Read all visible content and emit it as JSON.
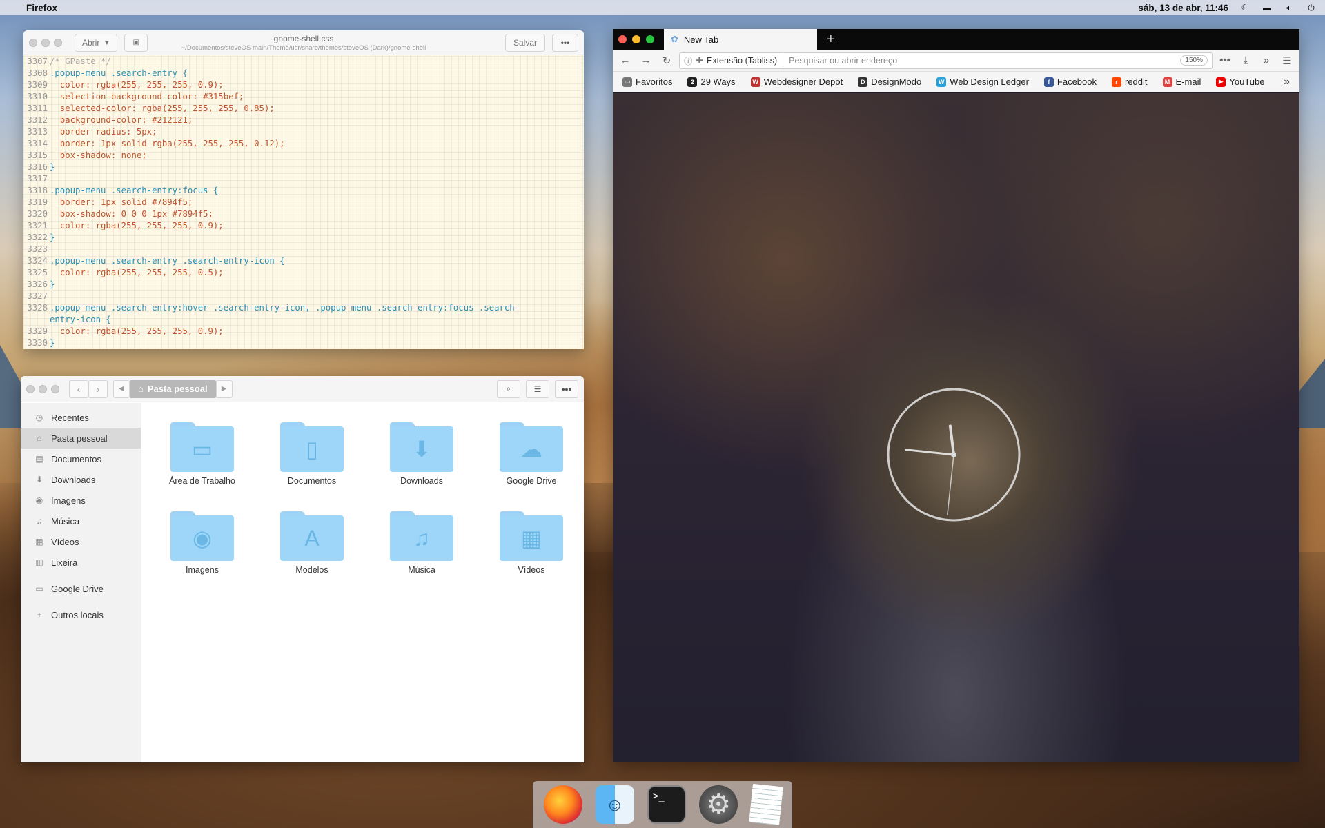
{
  "topbar": {
    "app": "Firefox",
    "datetime": "sáb, 13 de abr, 11:46",
    "icons": [
      "apple-icon",
      "night-mode-icon",
      "keyboard-icon",
      "volume-icon",
      "power-icon"
    ]
  },
  "editor": {
    "open_label": "Abrir",
    "filename": "gnome-shell.css",
    "path": "~/Documentos/steveOS main/Theme/usr/share/themes/steveOS (Dark)/gnome-shell",
    "save_label": "Salvar",
    "menu_label": "•••",
    "lines": [
      {
        "n": "3307",
        "t": "/* GPaste */"
      },
      {
        "n": "3308",
        "t": ".popup-menu .search-entry {"
      },
      {
        "n": "3309",
        "t": "  color: rgba(255, 255, 255, 0.9);"
      },
      {
        "n": "3310",
        "t": "  selection-background-color: #315bef;"
      },
      {
        "n": "3311",
        "t": "  selected-color: rgba(255, 255, 255, 0.85);"
      },
      {
        "n": "3312",
        "t": "  background-color: #212121;"
      },
      {
        "n": "3313",
        "t": "  border-radius: 5px;"
      },
      {
        "n": "3314",
        "t": "  border: 1px solid rgba(255, 255, 255, 0.12);"
      },
      {
        "n": "3315",
        "t": "  box-shadow: none;"
      },
      {
        "n": "3316",
        "t": "}"
      },
      {
        "n": "3317",
        "t": ""
      },
      {
        "n": "3318",
        "t": ".popup-menu .search-entry:focus {"
      },
      {
        "n": "3319",
        "t": "  border: 1px solid #7894f5;"
      },
      {
        "n": "3320",
        "t": "  box-shadow: 0 0 0 1px #7894f5;"
      },
      {
        "n": "3321",
        "t": "  color: rgba(255, 255, 255, 0.9);"
      },
      {
        "n": "3322",
        "t": "}"
      },
      {
        "n": "3323",
        "t": ""
      },
      {
        "n": "3324",
        "t": ".popup-menu .search-entry .search-entry-icon {"
      },
      {
        "n": "3325",
        "t": "  color: rgba(255, 255, 255, 0.5);"
      },
      {
        "n": "3326",
        "t": "}"
      },
      {
        "n": "3327",
        "t": ""
      },
      {
        "n": "3328",
        "t": ".popup-menu .search-entry:hover .search-entry-icon, .popup-menu .search-entry:focus .search-"
      },
      {
        "n": "",
        "t": "entry-icon {"
      },
      {
        "n": "3329",
        "t": "  color: rgba(255, 255, 255, 0.9);"
      },
      {
        "n": "3330",
        "t": "}"
      }
    ]
  },
  "files": {
    "breadcrumb": "Pasta pessoal",
    "sidebar": [
      {
        "label": "Recentes",
        "icon": "clock-icon",
        "glyph": "◷"
      },
      {
        "label": "Pasta pessoal",
        "icon": "home-icon",
        "glyph": "⌂",
        "selected": true
      },
      {
        "label": "Documentos",
        "icon": "document-icon",
        "glyph": "▤"
      },
      {
        "label": "Downloads",
        "icon": "download-icon",
        "glyph": "⬇"
      },
      {
        "label": "Imagens",
        "icon": "camera-icon",
        "glyph": "◉"
      },
      {
        "label": "Música",
        "icon": "music-icon",
        "glyph": "♫"
      },
      {
        "label": "Vídeos",
        "icon": "film-icon",
        "glyph": "▦"
      },
      {
        "label": "Lixeira",
        "icon": "trash-icon",
        "glyph": "▥"
      },
      {
        "label": "Google Drive",
        "icon": "drive-icon",
        "glyph": "▭"
      },
      {
        "label": "Outros locais",
        "icon": "plus-icon",
        "glyph": "+"
      }
    ],
    "folders": [
      {
        "label": "Área de Trabalho",
        "glyph": "▭"
      },
      {
        "label": "Documentos",
        "glyph": "▯"
      },
      {
        "label": "Downloads",
        "glyph": "⬇"
      },
      {
        "label": "Google Drive",
        "glyph": "☁"
      },
      {
        "label": "Imagens",
        "glyph": "◉"
      },
      {
        "label": "Modelos",
        "glyph": "A"
      },
      {
        "label": "Música",
        "glyph": "♫"
      },
      {
        "label": "Vídeos",
        "glyph": "▦"
      }
    ]
  },
  "firefox": {
    "tab_title": "New Tab",
    "url_ext": "Extensão (Tabliss)",
    "url_placeholder": "Pesquisar ou abrir endereço",
    "zoom": "150%",
    "bookmarks": [
      {
        "label": "Favoritos",
        "color": "#777",
        "g": "▭"
      },
      {
        "label": "29 Ways",
        "color": "#222",
        "g": "2"
      },
      {
        "label": "Webdesigner Depot",
        "color": "#b33",
        "g": "W"
      },
      {
        "label": "DesignModo",
        "color": "#333",
        "g": "D"
      },
      {
        "label": "Web Design Ledger",
        "color": "#2aa0d8",
        "g": "W"
      },
      {
        "label": "Facebook",
        "color": "#3b5998",
        "g": "f"
      },
      {
        "label": "reddit",
        "color": "#ff4500",
        "g": "r"
      },
      {
        "label": "E-mail",
        "color": "#d44",
        "g": "M"
      },
      {
        "label": "YouTube",
        "color": "#e00",
        "g": "▶"
      }
    ],
    "clock": {
      "hours": 11,
      "minutes": 46,
      "seconds": 31
    }
  },
  "dock": [
    {
      "name": "firefox-icon"
    },
    {
      "name": "finder-icon"
    },
    {
      "name": "terminal-icon",
      "g": ">_"
    },
    {
      "name": "settings-icon",
      "g": "⚙"
    },
    {
      "name": "text-editor-icon"
    }
  ]
}
